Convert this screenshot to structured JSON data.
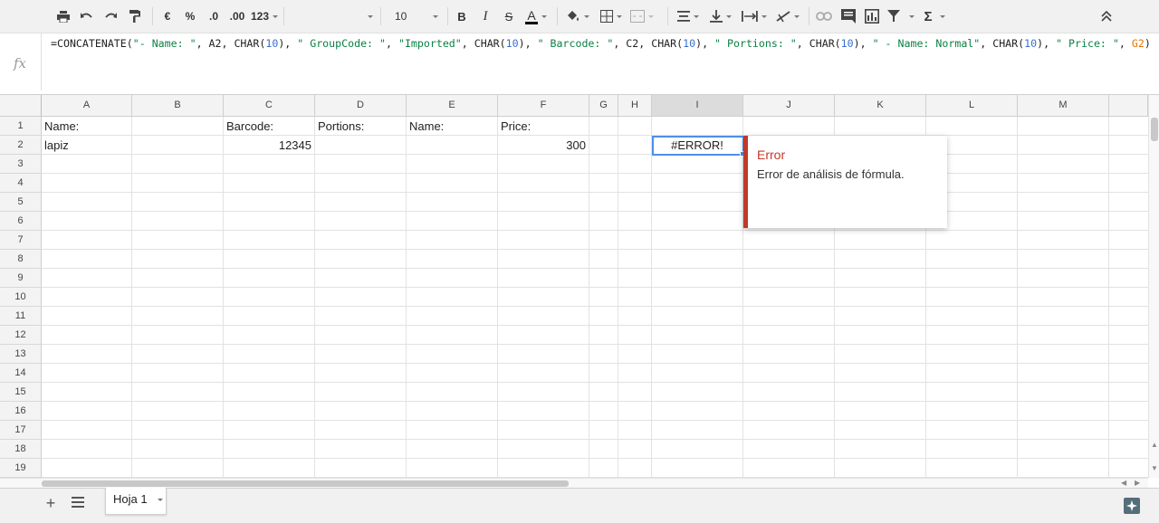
{
  "toolbar": {
    "buttons": [
      "print-icon",
      "undo-icon",
      "redo-icon",
      "paint-format-icon",
      "currency-icon",
      "percent-icon",
      "decrease-decimal-icon",
      "increase-decimal-icon",
      "more-formats-icon",
      "font-family-select",
      "font-size-select",
      "bold-icon",
      "italic-icon",
      "strikethrough-icon",
      "text-color-icon",
      "fill-color-icon",
      "borders-icon",
      "merge-cells-icon",
      "horizontal-align-icon",
      "vertical-align-icon",
      "text-wrap-icon",
      "text-rotation-icon",
      "link-icon",
      "comment-icon",
      "chart-icon",
      "filter-icon",
      "functions-icon",
      "collapse-icon"
    ],
    "currency_label": "€",
    "percent_label": "%",
    "decrease_decimal_label": ".0",
    "increase_decimal_label": ".00",
    "more_formats_label": "123",
    "font_family": "",
    "font_size": "10",
    "bold_label": "B",
    "italic_label": "I",
    "strike_label": "S",
    "text_color_label": "A",
    "functions_label": "Σ"
  },
  "formula_bar": {
    "icon_label": "fx",
    "parts": [
      {
        "t": "=CONCATENATE(",
        "c": ""
      },
      {
        "t": "\"- Name: \"",
        "c": "fs"
      },
      {
        "t": ", A2, CHAR(",
        "c": ""
      },
      {
        "t": "10",
        "c": "fn"
      },
      {
        "t": "), ",
        "c": ""
      },
      {
        "t": "\" GroupCode: \"",
        "c": "fs"
      },
      {
        "t": ", ",
        "c": ""
      },
      {
        "t": "\"Imported\"",
        "c": "fs"
      },
      {
        "t": ", CHAR(",
        "c": ""
      },
      {
        "t": "10",
        "c": "fn"
      },
      {
        "t": "), ",
        "c": ""
      },
      {
        "t": "\" Barcode: \"",
        "c": "fs"
      },
      {
        "t": ", C2, CHAR(",
        "c": ""
      },
      {
        "t": "10",
        "c": "fn"
      },
      {
        "t": "), ",
        "c": ""
      },
      {
        "t": "\" Portions: \"",
        "c": "fs"
      },
      {
        "t": ", CHAR(",
        "c": ""
      },
      {
        "t": "10",
        "c": "fn"
      },
      {
        "t": "), ",
        "c": ""
      },
      {
        "t": "\" - Name: Normal\"",
        "c": "fs"
      },
      {
        "t": ", CHAR(",
        "c": ""
      },
      {
        "t": "10",
        "c": "fn"
      },
      {
        "t": "), ",
        "c": ""
      },
      {
        "t": "\" Price: \"",
        "c": "fs"
      },
      {
        "t": ", ",
        "c": ""
      },
      {
        "t": "G2",
        "c": "fr"
      },
      {
        "t": ")",
        "c": ""
      }
    ]
  },
  "grid": {
    "columns": [
      "A",
      "B",
      "C",
      "D",
      "E",
      "F",
      "G",
      "H",
      "I",
      "J",
      "K",
      "L",
      "M"
    ],
    "rows": [
      "1",
      "2",
      "3",
      "4",
      "5",
      "6",
      "7",
      "8",
      "9",
      "10",
      "11",
      "12",
      "13",
      "14",
      "15",
      "16",
      "17",
      "18",
      "19"
    ],
    "selected_column": "I",
    "cells": {
      "A1": "Name:",
      "C1": "Barcode:",
      "D1": "Portions:",
      "E1": "Name:",
      "F1": "Price:",
      "A2": "lapiz",
      "C2": "12345",
      "F2": "300",
      "I2": "#ERROR!"
    }
  },
  "error_popup": {
    "title": "Error",
    "message": "Error de análisis de fórmula."
  },
  "sheets": {
    "active_tab": "Hoja 1"
  },
  "colors": {
    "selection": "#4d8fe8",
    "error": "#c53929",
    "string_literal": "#0b8043",
    "number_literal": "#3a6ecf",
    "reference": "#e37400"
  }
}
